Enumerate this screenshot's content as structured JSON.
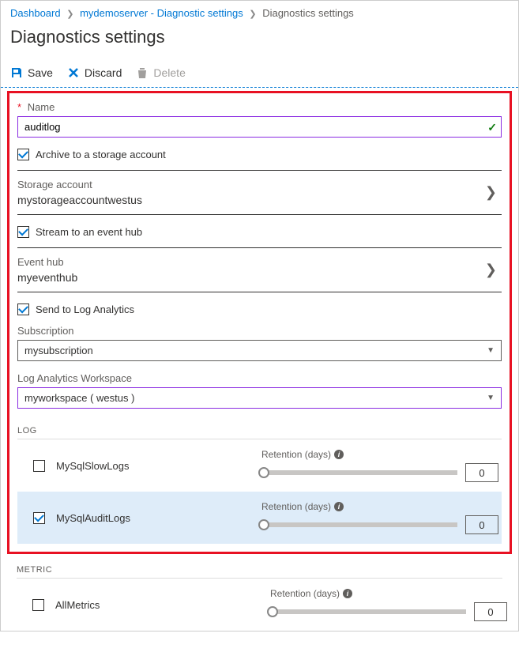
{
  "breadcrumb": {
    "dashboard": "Dashboard",
    "parent": "mydemoserver - Diagnostic settings",
    "current": "Diagnostics settings"
  },
  "page_title": "Diagnostics settings",
  "toolbar": {
    "save": "Save",
    "discard": "Discard",
    "delete": "Delete"
  },
  "form": {
    "name_label": "Name",
    "name_value": "auditlog",
    "archive_label": "Archive to a storage account",
    "storage_label": "Storage account",
    "storage_value": "mystorageaccountwestus",
    "stream_label": "Stream to an event hub",
    "eventhub_label": "Event hub",
    "eventhub_value": "myeventhub",
    "la_label": "Send to Log Analytics",
    "subscription_label": "Subscription",
    "subscription_value": "mysubscription",
    "workspace_label": "Log Analytics Workspace",
    "workspace_value": "myworkspace ( westus )"
  },
  "log_section": "LOG",
  "retention_label": "Retention (days)",
  "logs": [
    {
      "name": "MySqlSlowLogs",
      "checked": false,
      "retention": "0"
    },
    {
      "name": "MySqlAuditLogs",
      "checked": true,
      "retention": "0"
    }
  ],
  "metric_section": "METRIC",
  "metrics": [
    {
      "name": "AllMetrics",
      "checked": false,
      "retention": "0"
    }
  ]
}
